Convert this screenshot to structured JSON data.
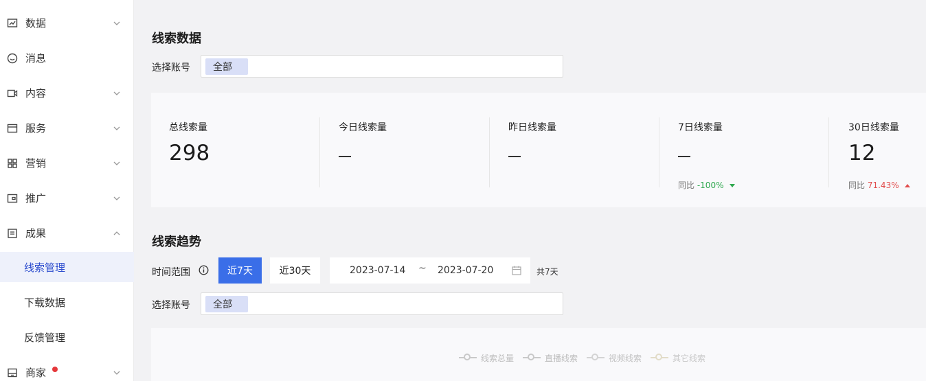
{
  "sidebar": {
    "items": [
      {
        "label": "数据",
        "icon": "chart-icon",
        "chevron": "down"
      },
      {
        "label": "消息",
        "icon": "message-icon",
        "chevron": "none"
      },
      {
        "label": "内容",
        "icon": "video-icon",
        "chevron": "down"
      },
      {
        "label": "服务",
        "icon": "window-icon",
        "chevron": "down"
      },
      {
        "label": "营销",
        "icon": "grid-icon",
        "chevron": "down"
      },
      {
        "label": "推广",
        "icon": "wallet-icon",
        "chevron": "down"
      },
      {
        "label": "成果",
        "icon": "document-icon",
        "chevron": "up"
      }
    ],
    "sub_items": [
      {
        "label": "线索管理",
        "active": true
      },
      {
        "label": "下载数据",
        "active": false
      },
      {
        "label": "反馈管理",
        "active": false
      }
    ],
    "merchant": {
      "label": "商家",
      "icon": "store-icon",
      "badge_color": "#e5383b"
    }
  },
  "lead_data": {
    "title": "线索数据",
    "account_label": "选择账号",
    "account_tag": "全部",
    "stats": [
      {
        "label": "总线索量",
        "value": "298",
        "compare_label": "",
        "compare_value": ""
      },
      {
        "label": "今日线索量",
        "value": "",
        "compare_label": "",
        "compare_value": ""
      },
      {
        "label": "昨日线索量",
        "value": "",
        "compare_label": "",
        "compare_value": ""
      },
      {
        "label": "7日线索量",
        "value": "",
        "compare_label": "同比",
        "compare_value": "-100%",
        "trend": "down"
      },
      {
        "label": "30日线索量",
        "value": "12",
        "compare_label": "同比",
        "compare_value": "71.43%",
        "trend": "up"
      }
    ]
  },
  "lead_trend": {
    "title": "线索趋势",
    "time_range_label": "时间范围",
    "range_7": "近7天",
    "range_30": "近30天",
    "start_date": "2023-07-14",
    "tilde": "~",
    "end_date": "2023-07-20",
    "span_text": "共7天",
    "account_label": "选择账号",
    "account_tag": "全部",
    "legend": [
      {
        "label": "线索总量",
        "color": "#c9c9c9"
      },
      {
        "label": "直播线索",
        "color": "#c9c9c9"
      },
      {
        "label": "视频线索",
        "color": "#d4d4d4"
      },
      {
        "label": "其它线索",
        "color": "#e2dcc8"
      }
    ]
  },
  "colors": {
    "accent": "#3a6ee8",
    "active_nav_text": "#2f4fcf",
    "trend_down": "#2fa84f",
    "trend_up": "#e14d4d"
  }
}
